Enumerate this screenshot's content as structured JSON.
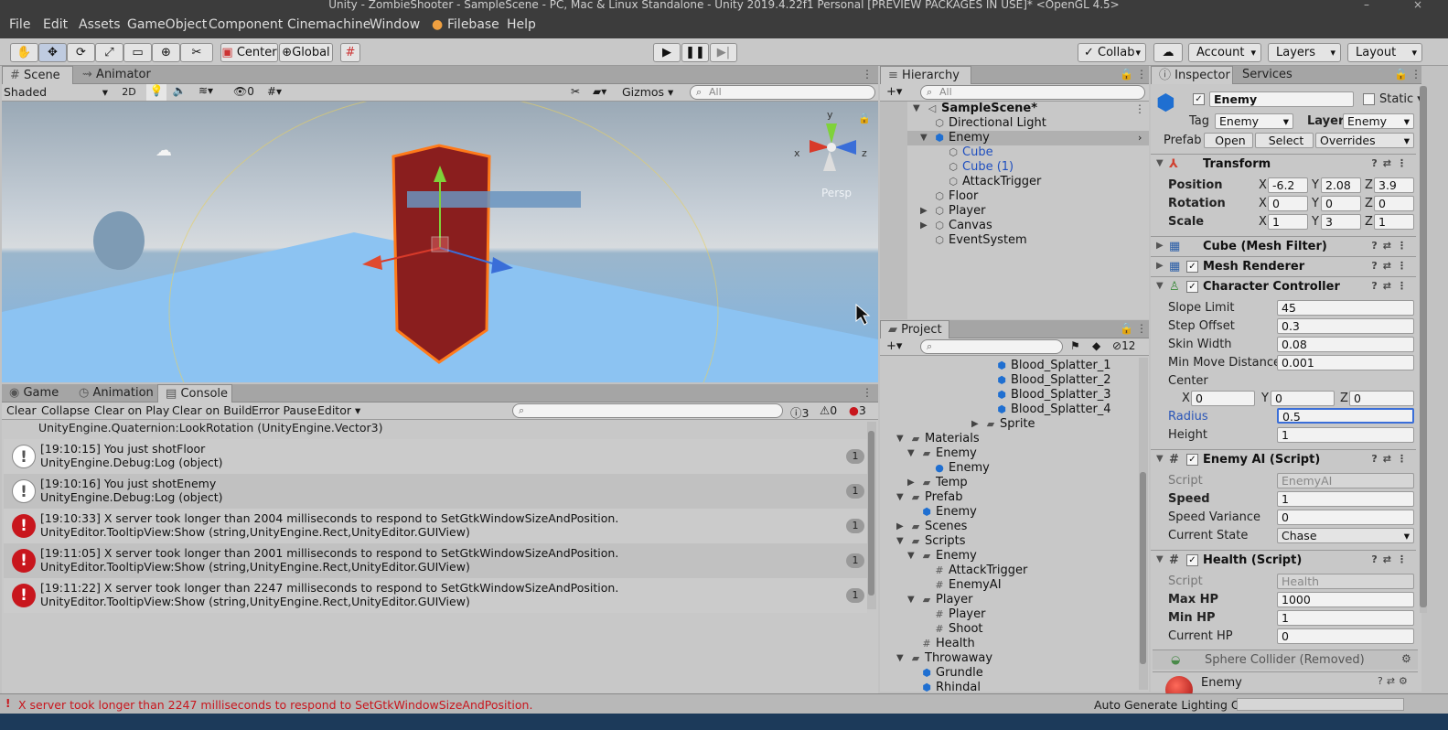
{
  "window": {
    "title": "Unity - ZombieShooter - SampleScene - PC, Mac & Linux Standalone - Unity 2019.4.22f1 Personal [PREVIEW PACKAGES IN USE]* <OpenGL 4.5>"
  },
  "menu": [
    "File",
    "Edit",
    "Assets",
    "GameObject",
    "Component",
    "Cinemachine",
    "Window",
    "Filebase",
    "Help"
  ],
  "toolbar": {
    "pivot": "Center",
    "space": "Global",
    "collab": "Collab",
    "account": "Account",
    "layers": "Layers",
    "layout": "Layout"
  },
  "scene": {
    "tabs": [
      "Scene",
      "Animator"
    ],
    "shading": "Shaded",
    "mode2d": "2D",
    "hidden_count": "0",
    "gizmos": "Gizmos",
    "search_placeholder": "All",
    "persp": "Persp",
    "axis": {
      "x": "x",
      "y": "y",
      "z": "z"
    }
  },
  "hierarchy": {
    "tab": "Hierarchy",
    "search_placeholder": "All",
    "scene_name": "SampleScene*",
    "items": [
      "Directional Light",
      "Enemy",
      "Cube",
      "Cube (1)",
      "AttackTrigger",
      "Floor",
      "Player",
      "Canvas",
      "EventSystem"
    ]
  },
  "project": {
    "tab": "Project",
    "hidden_count": "12",
    "items": [
      "Blood_Splatter_1",
      "Blood_Splatter_2",
      "Blood_Splatter_3",
      "Blood_Splatter_4",
      "Sprite",
      "Materials",
      "Enemy",
      "Enemy",
      "Temp",
      "Prefab",
      "Enemy",
      "Scenes",
      "Scripts",
      "Enemy",
      "AttackTrigger",
      "EnemyAI",
      "Player",
      "Player",
      "Shoot",
      "Health",
      "Throwaway",
      "Grundle",
      "Rhindal"
    ]
  },
  "console": {
    "tabs": [
      "Game",
      "Animation",
      "Console"
    ],
    "buttons": {
      "clear": "Clear",
      "collapse": "Collapse",
      "clear_on_play": "Clear on Play",
      "clear_on_build": "Clear on Build",
      "error_pause": "Error Pause",
      "editor": "Editor"
    },
    "counts": {
      "info": "3",
      "warn": "0",
      "error": "3"
    },
    "partial_line": "UnityEngine.Quaternion:LookRotation (UnityEngine.Vector3)",
    "rows": [
      {
        "type": "info",
        "l1": "[19:10:15] You just shotFloor",
        "l2": "UnityEngine.Debug:Log (object)",
        "count": "1"
      },
      {
        "type": "info",
        "l1": "[19:10:16] You just shotEnemy",
        "l2": "UnityEngine.Debug:Log (object)",
        "count": "1"
      },
      {
        "type": "err",
        "l1": "[19:10:33] X server took longer than 2004 milliseconds to respond to SetGtkWindowSizeAndPosition.",
        "l2": "UnityEditor.TooltipView:Show (string,UnityEngine.Rect,UnityEditor.GUIView)",
        "count": "1"
      },
      {
        "type": "err",
        "l1": "[19:11:05] X server took longer than 2001 milliseconds to respond to SetGtkWindowSizeAndPosition.",
        "l2": "UnityEditor.TooltipView:Show (string,UnityEngine.Rect,UnityEditor.GUIView)",
        "count": "1"
      },
      {
        "type": "err",
        "l1": "[19:11:22] X server took longer than 2247 milliseconds to respond to SetGtkWindowSizeAndPosition.",
        "l2": "UnityEditor.TooltipView:Show (string,UnityEngine.Rect,UnityEditor.GUIView)",
        "count": "1"
      }
    ]
  },
  "inspector": {
    "tabs": [
      "Inspector",
      "Services"
    ],
    "name": "Enemy",
    "static": "Static",
    "tag_label": "Tag",
    "tag": "Enemy",
    "layer_label": "Layer",
    "layer": "Enemy",
    "prefab_label": "Prefab",
    "open": "Open",
    "select": "Select",
    "overrides": "Overrides",
    "transform": {
      "title": "Transform",
      "position": "Position",
      "rotation": "Rotation",
      "scale": "Scale",
      "pos": [
        "-6.2",
        "2.08",
        "3.9"
      ],
      "rot": [
        "0",
        "0",
        "0"
      ],
      "scl": [
        "1",
        "3",
        "1"
      ]
    },
    "axes": [
      "X",
      "Y",
      "Z"
    ],
    "mesh_filter": "Cube (Mesh Filter)",
    "mesh_renderer": "Mesh Renderer",
    "cc": {
      "title": "Character Controller",
      "slope_label": "Slope Limit",
      "slope": "45",
      "step_label": "Step Offset",
      "step": "0.3",
      "skin_label": "Skin Width",
      "skin": "0.08",
      "minmove_label": "Min Move Distance",
      "minmove": "0.001",
      "center_label": "Center",
      "center": [
        "0",
        "0",
        "0"
      ],
      "radius_label": "Radius",
      "radius": "0.5",
      "height_label": "Height",
      "height": "1"
    },
    "ai": {
      "title": "Enemy AI (Script)",
      "script_label": "Script",
      "script": "EnemyAI",
      "speed_label": "Speed",
      "speed": "1",
      "variance_label": "Speed Variance",
      "variance": "0",
      "state_label": "Current State",
      "state": "Chase"
    },
    "health": {
      "title": "Health (Script)",
      "script_label": "Script",
      "script": "Health",
      "max_label": "Max HP",
      "max": "1000",
      "min_label": "Min HP",
      "min": "1",
      "cur_label": "Current HP",
      "cur": "0"
    },
    "sphere": "Sphere Collider (Removed)",
    "material": "Enemy"
  },
  "status": {
    "message": "X server took longer than 2247 milliseconds to respond to SetGtkWindowSizeAndPosition.",
    "lighting": "Auto Generate Lighting Off"
  }
}
